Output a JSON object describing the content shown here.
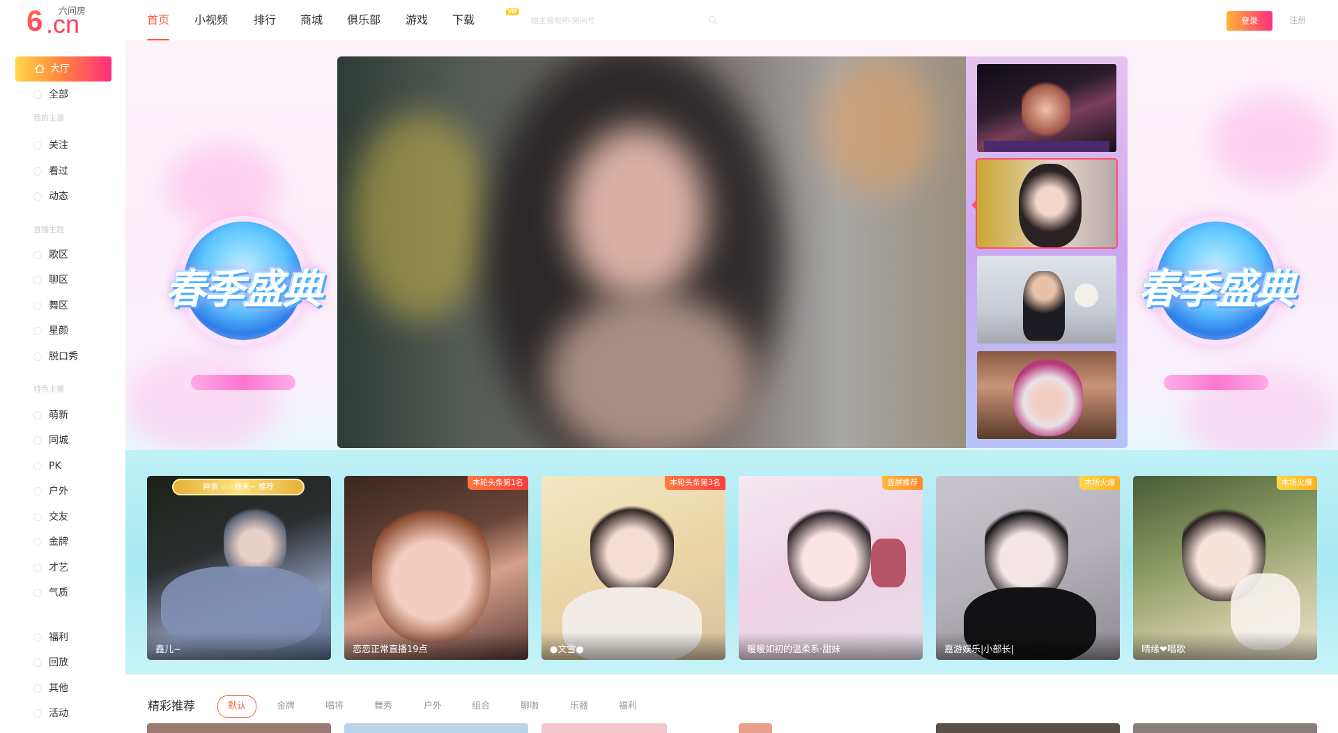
{
  "logo": {
    "mark": "6",
    "domain": ".cn",
    "tagline": "六间房"
  },
  "sidebar": {
    "active": {
      "label": "大厅",
      "icon": "home-icon"
    },
    "items": [
      {
        "label": "全部",
        "icon": "grid-icon"
      },
      {
        "label": "关注",
        "icon": "heart-icon"
      },
      {
        "label": "看过",
        "icon": "eye-icon"
      },
      {
        "label": "动态",
        "icon": "activity-icon"
      },
      {
        "label": "歌区",
        "icon": "music-icon"
      },
      {
        "label": "聊区",
        "icon": "chat-icon"
      },
      {
        "label": "舞区",
        "icon": "dance-icon"
      },
      {
        "label": "星颜",
        "icon": "star-icon"
      },
      {
        "label": "脱口秀",
        "icon": "mic-icon"
      },
      {
        "label": "萌新",
        "icon": "sprout-icon"
      },
      {
        "label": "同城",
        "icon": "location-icon"
      },
      {
        "label": "PK",
        "icon": "pk-icon"
      },
      {
        "label": "户外",
        "icon": "outdoor-icon"
      },
      {
        "label": "交友",
        "icon": "friends-icon"
      },
      {
        "label": "金牌",
        "icon": "medal-icon"
      },
      {
        "label": "才艺",
        "icon": "talent-icon"
      },
      {
        "label": "气质",
        "icon": "sparkle-icon"
      },
      {
        "label": "福利",
        "icon": "gift-icon"
      },
      {
        "label": "回放",
        "icon": "replay-icon"
      },
      {
        "label": "其他",
        "icon": "more-icon"
      },
      {
        "label": "活动",
        "icon": "event-icon"
      }
    ],
    "headings": [
      "我的主播",
      "直播主题",
      "特色主播"
    ]
  },
  "header": {
    "nav": [
      {
        "label": "首页",
        "active": true
      },
      {
        "label": "小视频"
      },
      {
        "label": "排行"
      },
      {
        "label": "商城"
      },
      {
        "label": "俱乐部",
        "badge": "VIP"
      },
      {
        "label": "游戏"
      },
      {
        "label": "下载"
      }
    ],
    "search_placeholder": "搜主播昵称/房间号",
    "login": "登录",
    "register": "注册"
  },
  "hero": {
    "banner_title": "春季盛典",
    "thumbnails": 4,
    "selected_thumbnail": 2
  },
  "featured": [
    {
      "name": "鑫儿~",
      "badge": "",
      "crown": "神豪 ☆☆缘来~ 推荐"
    },
    {
      "name": "恋恋正常直播19点",
      "badge": "本轮头条第1名",
      "badge_style": "red"
    },
    {
      "name": "●文雪●",
      "badge": "本轮头条第3名",
      "badge_style": "red"
    },
    {
      "name": "暖暖如初的温柔系·甜妹",
      "badge": "竖屏推荐",
      "badge_style": "orange"
    },
    {
      "name": "嘉游娱乐|小部长|",
      "badge": "本场火爆",
      "badge_style": "gold"
    },
    {
      "name": "晴缘❤唱歌",
      "badge": "本场火爆",
      "badge_style": "gold"
    }
  ],
  "recommend": {
    "title": "精彩推荐",
    "filters": [
      "默认",
      "金牌",
      "唱将",
      "舞秀",
      "户外",
      "组合",
      "聊咖",
      "乐器",
      "福利"
    ],
    "active_filter": "默认"
  },
  "colors": {
    "accent": "#ff5a3c",
    "brand_gradient_start": "#ffd84a",
    "brand_gradient_end": "#ff2d7c"
  }
}
